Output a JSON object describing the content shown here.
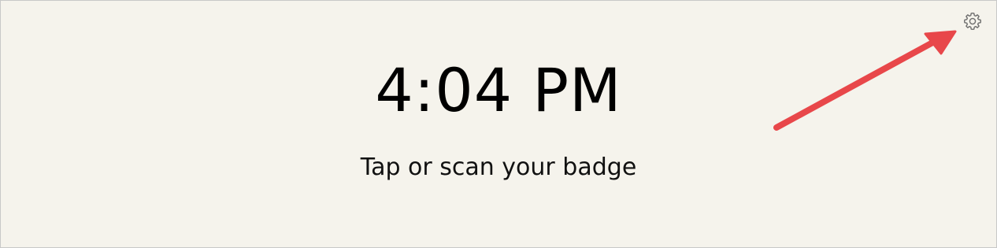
{
  "clock": {
    "time": "4:04 PM"
  },
  "prompt": {
    "text": "Tap or scan your badge"
  },
  "settings": {
    "icon": "gear-icon"
  },
  "colors": {
    "background": "#f5f3ec",
    "annotation_arrow": "#e8474a",
    "icon": "#6e6e6e"
  }
}
